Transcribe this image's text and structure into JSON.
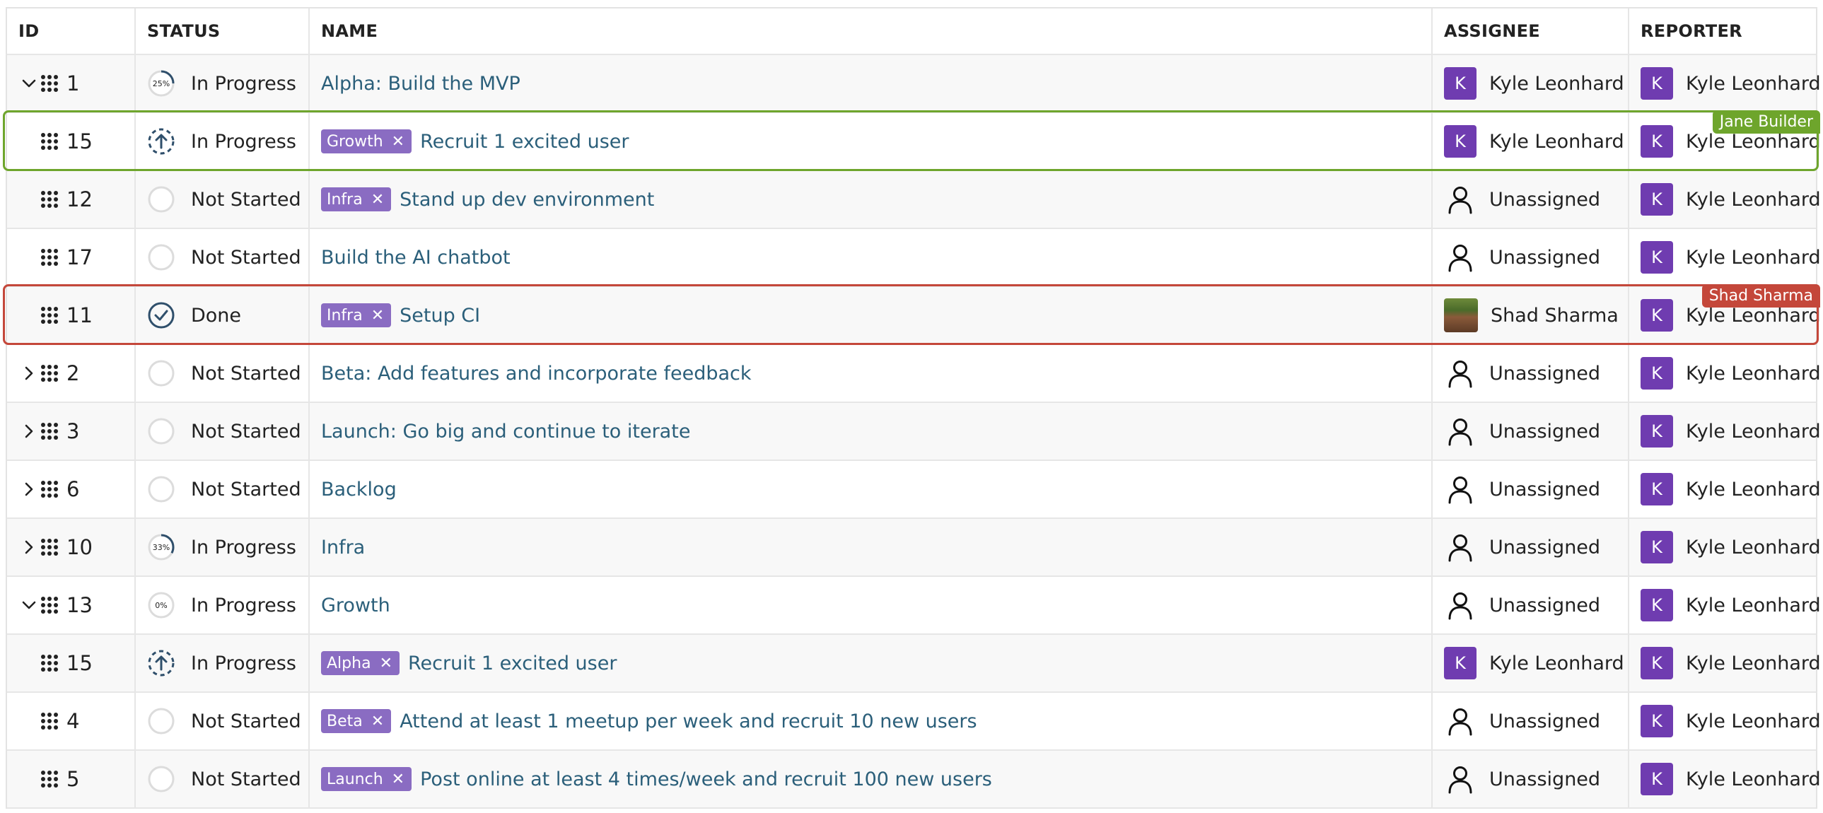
{
  "columns": {
    "id": "ID",
    "status": "STATUS",
    "name": "NAME",
    "assignee": "ASSIGNEE",
    "reporter": "REPORTER"
  },
  "rows": [
    {
      "id": "1",
      "expand": "down",
      "status": "In Progress",
      "progress": "25%",
      "tag": "",
      "name": "Alpha: Build the MVP",
      "assignee": "Kyle Leonhard",
      "assignee_avatar": "K",
      "reporter": "Kyle Leonhard",
      "reporter_avatar": "K"
    },
    {
      "id": "15",
      "expand": "none",
      "status": "In Progress",
      "progress": "",
      "tag": "Growth",
      "name": "Recruit 1 excited user",
      "assignee": "Kyle Leonhard",
      "assignee_avatar": "K",
      "reporter": "Kyle Leonhard",
      "reporter_avatar": "K"
    },
    {
      "id": "12",
      "expand": "none",
      "status": "Not Started",
      "progress": "",
      "tag": "Infra",
      "name": "Stand up dev environment",
      "assignee": "Unassigned",
      "assignee_avatar": "",
      "reporter": "Kyle Leonhard",
      "reporter_avatar": "K"
    },
    {
      "id": "17",
      "expand": "none",
      "status": "Not Started",
      "progress": "",
      "tag": "",
      "name": "Build the AI chatbot",
      "assignee": "Unassigned",
      "assignee_avatar": "",
      "reporter": "Kyle Leonhard",
      "reporter_avatar": "K"
    },
    {
      "id": "11",
      "expand": "none",
      "status": "Done",
      "progress": "",
      "tag": "Infra",
      "name": "Setup CI",
      "assignee": "Shad Sharma",
      "assignee_avatar": "photo",
      "reporter": "Kyle Leonhard",
      "reporter_avatar": "K"
    },
    {
      "id": "2",
      "expand": "right",
      "status": "Not Started",
      "progress": "",
      "tag": "",
      "name": "Beta: Add features and incorporate feedback",
      "assignee": "Unassigned",
      "assignee_avatar": "",
      "reporter": "Kyle Leonhard",
      "reporter_avatar": "K"
    },
    {
      "id": "3",
      "expand": "right",
      "status": "Not Started",
      "progress": "",
      "tag": "",
      "name": "Launch: Go big and continue to iterate",
      "assignee": "Unassigned",
      "assignee_avatar": "",
      "reporter": "Kyle Leonhard",
      "reporter_avatar": "K"
    },
    {
      "id": "6",
      "expand": "right",
      "status": "Not Started",
      "progress": "",
      "tag": "",
      "name": "Backlog",
      "assignee": "Unassigned",
      "assignee_avatar": "",
      "reporter": "Kyle Leonhard",
      "reporter_avatar": "K"
    },
    {
      "id": "10",
      "expand": "right",
      "status": "In Progress",
      "progress": "33%",
      "tag": "",
      "name": "Infra",
      "assignee": "Unassigned",
      "assignee_avatar": "",
      "reporter": "Kyle Leonhard",
      "reporter_avatar": "K"
    },
    {
      "id": "13",
      "expand": "down",
      "status": "In Progress",
      "progress": "0%",
      "tag": "",
      "name": "Growth",
      "assignee": "Unassigned",
      "assignee_avatar": "",
      "reporter": "Kyle Leonhard",
      "reporter_avatar": "K"
    },
    {
      "id": "15",
      "expand": "none",
      "status": "In Progress",
      "progress": "",
      "tag": "Alpha",
      "name": "Recruit 1 excited user",
      "assignee": "Kyle Leonhard",
      "assignee_avatar": "K",
      "reporter": "Kyle Leonhard",
      "reporter_avatar": "K"
    },
    {
      "id": "4",
      "expand": "none",
      "status": "Not Started",
      "progress": "",
      "tag": "Beta",
      "name": "Attend at least 1 meetup per week and recruit 10 new users",
      "assignee": "Unassigned",
      "assignee_avatar": "",
      "reporter": "Kyle Leonhard",
      "reporter_avatar": "K"
    },
    {
      "id": "5",
      "expand": "none",
      "status": "Not Started",
      "progress": "",
      "tag": "Launch",
      "name": "Post online at least 4 times/week and recruit 100 new users",
      "assignee": "Unassigned",
      "assignee_avatar": "",
      "reporter": "Kyle Leonhard",
      "reporter_avatar": "K"
    }
  ],
  "presence": [
    {
      "user": "Jane Builder",
      "row": 1,
      "color": "#6ea52c"
    },
    {
      "user": "Shad Sharma",
      "row": 4,
      "color": "#c4473a"
    }
  ],
  "icons": {
    "expand_down": "chevron-down-icon",
    "expand_right": "chevron-right-icon",
    "drag": "drag-handle-icon",
    "tag_remove": "close-icon",
    "unassigned": "person-icon"
  },
  "colors": {
    "link": "#2b5f7a",
    "tag": "#8a6cc2",
    "avatar": "#6f3cb0",
    "status_icon": "#2f4f6b"
  }
}
